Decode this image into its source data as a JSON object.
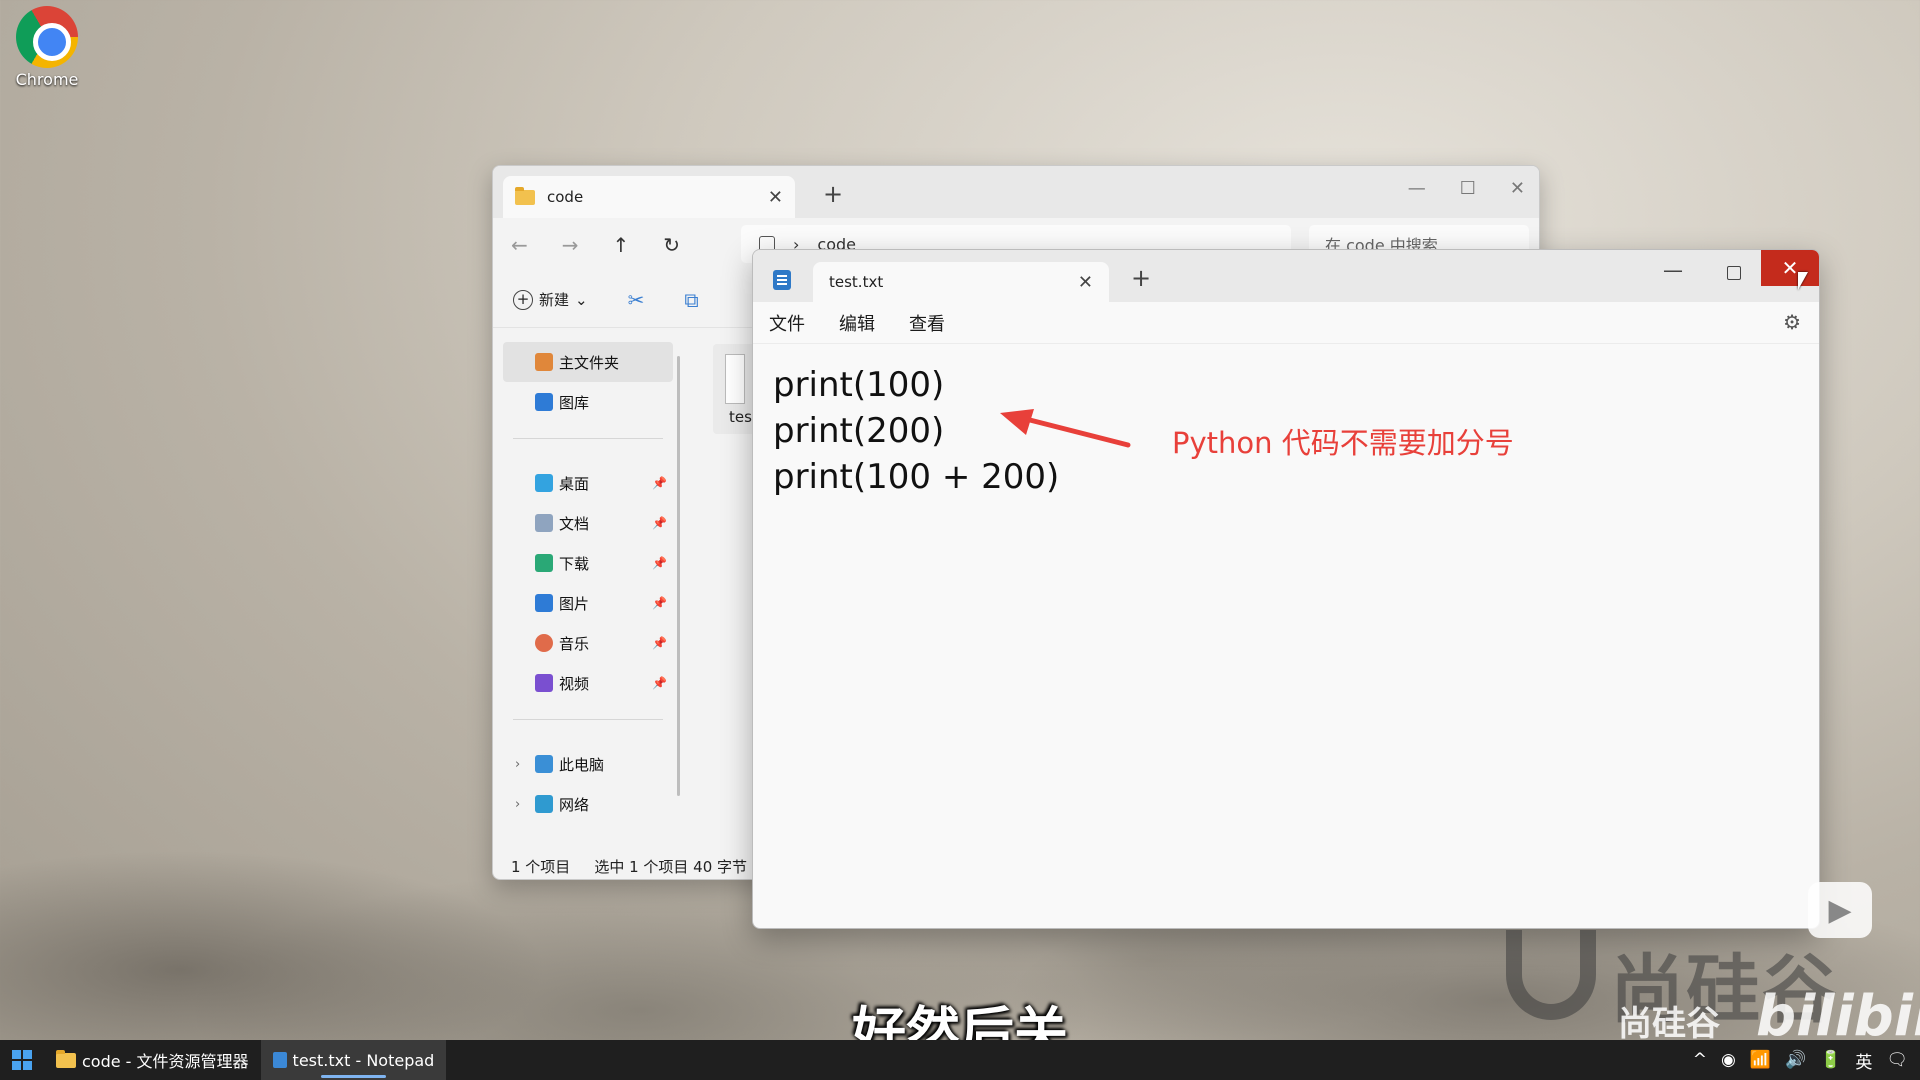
{
  "desktop": {
    "icons": [
      {
        "label": "Chrome",
        "icon": "chrome-icon"
      }
    ]
  },
  "explorer": {
    "tab_title": "code",
    "tab_close": "✕",
    "new_tab": "+",
    "window_controls": {
      "minimize": "—",
      "maximize": "☐",
      "close": "✕"
    },
    "nav": {
      "back": "←",
      "forward": "→",
      "up": "↑",
      "refresh": "↻"
    },
    "address": {
      "separator": "›",
      "path": "code"
    },
    "search_placeholder": "在 code 中搜索",
    "command_bar": {
      "new_label": "新建"
    },
    "sidebar": {
      "quick": [
        {
          "label": "主文件夹",
          "icon": "home-icon"
        },
        {
          "label": "图库",
          "icon": "gallery-icon"
        }
      ],
      "pinned": [
        {
          "label": "桌面",
          "icon": "desktop-icon"
        },
        {
          "label": "文档",
          "icon": "documents-icon"
        },
        {
          "label": "下载",
          "icon": "download-icon"
        },
        {
          "label": "图片",
          "icon": "pictures-icon"
        },
        {
          "label": "音乐",
          "icon": "music-icon"
        },
        {
          "label": "视频",
          "icon": "videos-icon"
        }
      ],
      "drives": [
        {
          "label": "此电脑",
          "icon": "computer-icon"
        },
        {
          "label": "网络",
          "icon": "network-icon"
        }
      ]
    },
    "file_name_partial": "tes",
    "status": {
      "count": "1 个项目",
      "selected": "选中 1 个项目  40 字节"
    }
  },
  "notepad": {
    "tab_title": "test.txt",
    "tab_close": "✕",
    "new_tab": "+",
    "window_controls": {
      "minimize": "—",
      "close": "✕"
    },
    "menu": [
      "文件",
      "编辑",
      "查看"
    ],
    "lines": [
      "print(100)",
      "print(200)",
      "print(100 + 200)"
    ]
  },
  "annotation": {
    "text": "Python 代码不需要加分号",
    "color": "#e8403a"
  },
  "watermark": {
    "brand": "尚硅谷",
    "brand_sub": "尚硅谷",
    "site": "bilibili"
  },
  "subtitle": "好然后关",
  "taskbar": {
    "items": [
      {
        "label": "code - 文件资源管理器",
        "icon": "folder-icon",
        "active": false
      },
      {
        "label": "test.txt - Notepad",
        "icon": "notepad-icon",
        "active": true
      }
    ],
    "tray": {
      "chevron": "^",
      "ime": "英"
    }
  },
  "colors": {
    "close_red": "#c42b1c",
    "accent_blue": "#3b7fd1"
  }
}
